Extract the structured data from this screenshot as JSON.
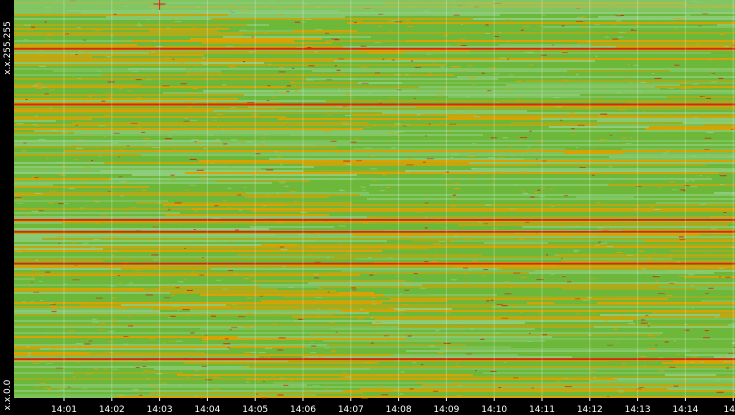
{
  "chart_data": {
    "type": "heatmap",
    "title": "",
    "xlabel": "",
    "ylabel": "",
    "y_ticks": [
      "x.x.0.0",
      "x.x.255.255"
    ],
    "x_ticks": [
      "14:01",
      "14:02",
      "14:03",
      "14:04",
      "14:05",
      "14:06",
      "14:07",
      "14:08",
      "14:09",
      "14:10",
      "14:11",
      "14:12",
      "14:13",
      "14:14",
      "14"
    ],
    "grid": true,
    "colors": {
      "background": "#000000",
      "low": "#8fce7f",
      "mid": "#6db83a",
      "high": "#e3a000",
      "peak": "#d42a10",
      "text": "#ffffff"
    },
    "notable_rows": [
      {
        "y_fraction": 0.88,
        "intensity": "peak"
      },
      {
        "y_fraction": 0.45,
        "intensity": "peak"
      },
      {
        "y_fraction": 0.42,
        "intensity": "peak"
      },
      {
        "y_fraction": 0.74,
        "intensity": "peak"
      },
      {
        "y_fraction": 0.34,
        "intensity": "peak"
      },
      {
        "y_fraction": 0.1,
        "intensity": "peak"
      }
    ],
    "marker": {
      "x_tick": "14:03",
      "y_fraction": 0.99,
      "symbol": "+"
    }
  }
}
